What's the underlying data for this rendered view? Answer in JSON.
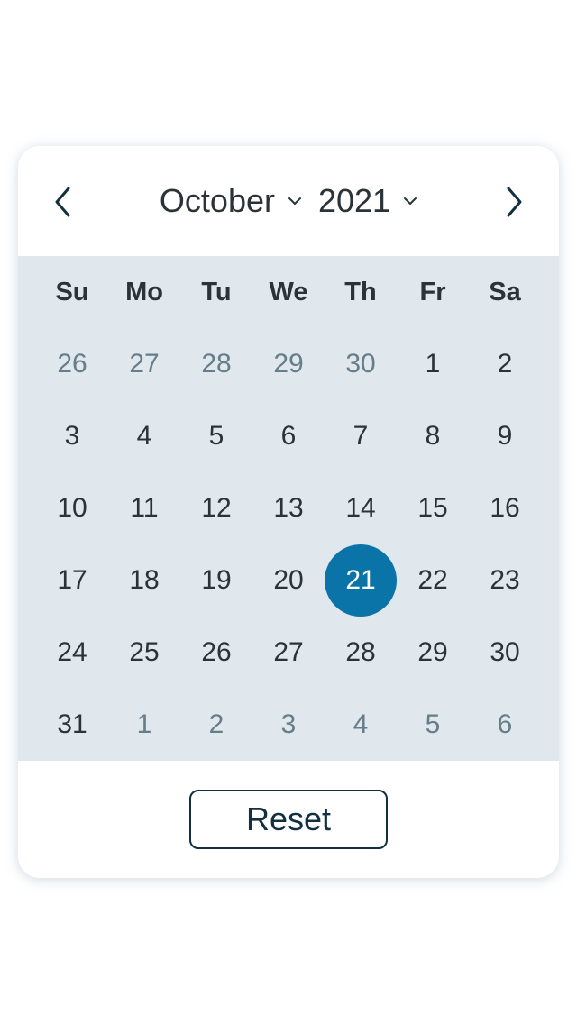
{
  "calendar": {
    "month": "October",
    "year": "2021",
    "weekdays": [
      "Su",
      "Mo",
      "Tu",
      "We",
      "Th",
      "Fr",
      "Sa"
    ],
    "weeks": [
      [
        {
          "d": "26",
          "muted": true
        },
        {
          "d": "27",
          "muted": true
        },
        {
          "d": "28",
          "muted": true
        },
        {
          "d": "29",
          "muted": true
        },
        {
          "d": "30",
          "muted": true
        },
        {
          "d": "1"
        },
        {
          "d": "2"
        }
      ],
      [
        {
          "d": "3"
        },
        {
          "d": "4"
        },
        {
          "d": "5"
        },
        {
          "d": "6"
        },
        {
          "d": "7"
        },
        {
          "d": "8"
        },
        {
          "d": "9"
        }
      ],
      [
        {
          "d": "10"
        },
        {
          "d": "11"
        },
        {
          "d": "12"
        },
        {
          "d": "13"
        },
        {
          "d": "14"
        },
        {
          "d": "15"
        },
        {
          "d": "16"
        }
      ],
      [
        {
          "d": "17"
        },
        {
          "d": "18"
        },
        {
          "d": "19"
        },
        {
          "d": "20"
        },
        {
          "d": "21",
          "selected": true
        },
        {
          "d": "22"
        },
        {
          "d": "23"
        }
      ],
      [
        {
          "d": "24"
        },
        {
          "d": "25"
        },
        {
          "d": "26"
        },
        {
          "d": "27"
        },
        {
          "d": "28"
        },
        {
          "d": "29"
        },
        {
          "d": "30"
        }
      ],
      [
        {
          "d": "31"
        },
        {
          "d": "1",
          "muted": true
        },
        {
          "d": "2",
          "muted": true
        },
        {
          "d": "3",
          "muted": true
        },
        {
          "d": "4",
          "muted": true
        },
        {
          "d": "5",
          "muted": true
        },
        {
          "d": "6",
          "muted": true
        }
      ]
    ],
    "reset_label": "Reset",
    "icons": {
      "prev": "chevron-left-icon",
      "next": "chevron-right-icon",
      "dropdown": "chevron-down-icon"
    },
    "colors": {
      "selected": "#0a73a8",
      "grid_background": "#e0e8ee",
      "muted_text": "#667d8a",
      "text": "#2b3338"
    }
  }
}
